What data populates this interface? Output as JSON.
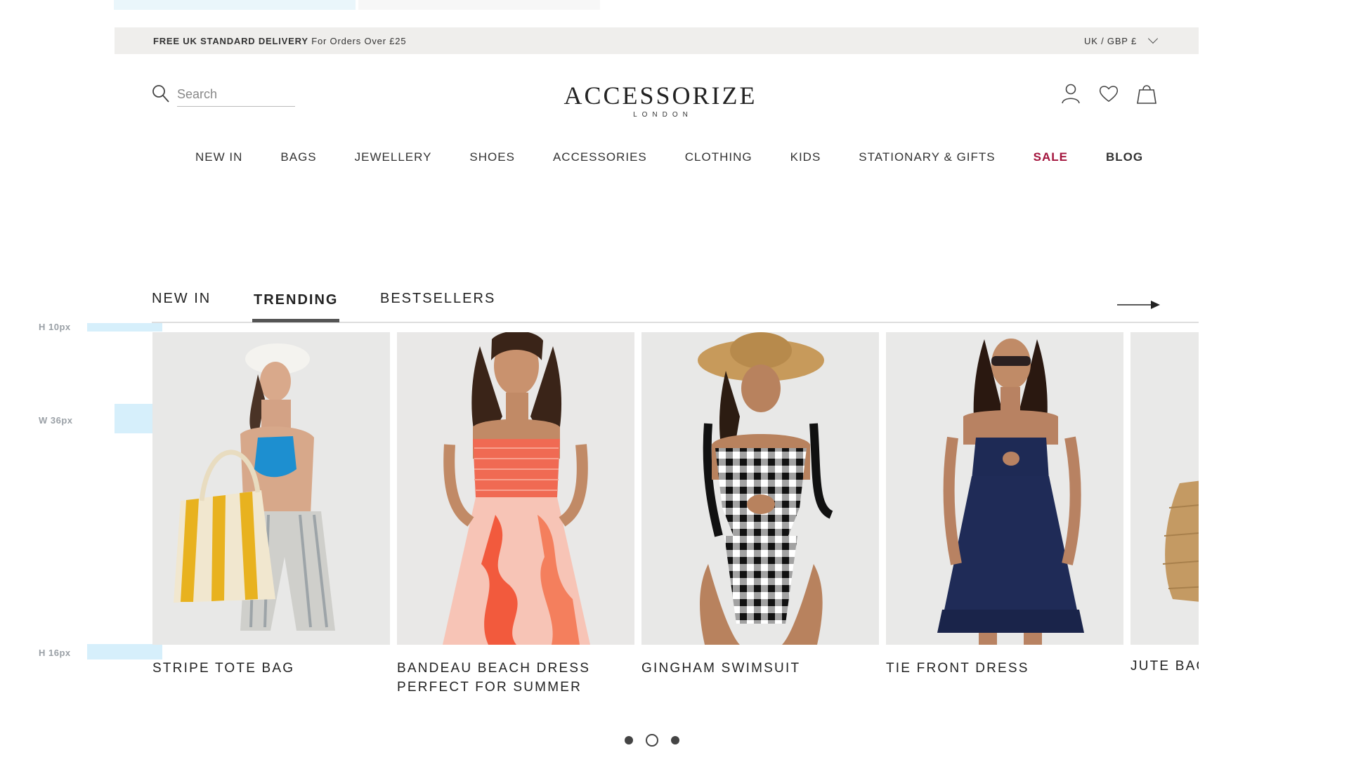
{
  "promo": {
    "bold": "FREE UK STANDARD DELIVERY",
    "text": "For Orders Over £25",
    "region": "UK / GBP £"
  },
  "search": {
    "placeholder": "Search"
  },
  "logo": {
    "main": "ACCESSORIZE",
    "sub": "LONDON"
  },
  "nav": [
    "NEW IN",
    "BAGS",
    "JEWELLERY",
    "SHOES",
    "ACCESSORIES",
    "CLOTHING",
    "KIDS",
    "STATIONARY & GIFTS",
    "SALE",
    "BLOG"
  ],
  "tabs": [
    "NEW IN",
    "TRENDING",
    "BESTSELLERS"
  ],
  "active_tab": "TRENDING",
  "products": [
    {
      "title": "STRIPE TOTE BAG"
    },
    {
      "title": "BANDEAU BEACH DRESS PERFECT FOR SUMMER"
    },
    {
      "title": "GINGHAM SWIMSUIT"
    },
    {
      "title": "TIE FRONT DRESS"
    },
    {
      "title": "JUTE BAG"
    }
  ],
  "spec_labels": {
    "h10": "H 10px",
    "w36": "W 36px",
    "h16": "H 16px"
  },
  "colors": {
    "sale": "#a3133c",
    "promo_bg": "#efeeec",
    "spec": "#d6effb"
  },
  "pagination": {
    "pages": 3,
    "current": 2
  }
}
